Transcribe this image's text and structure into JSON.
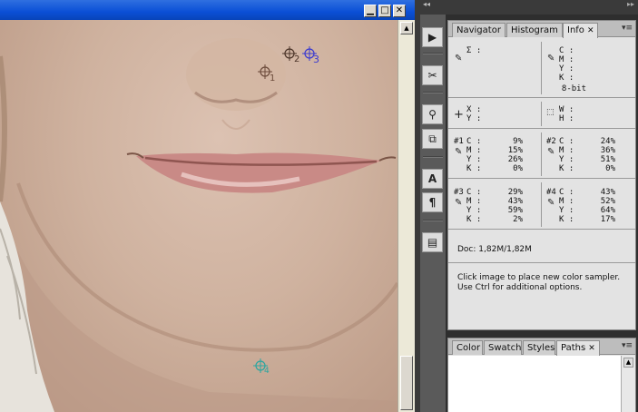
{
  "window": {
    "buttons": {
      "minimize": "▁",
      "maximize": "□",
      "close": "✕"
    }
  },
  "samplers": [
    {
      "label": "1",
      "color": "#6b4a3a"
    },
    {
      "label": "2",
      "color": "#4a3328"
    },
    {
      "label": "3",
      "color": "#3a3ad0"
    },
    {
      "label": "4",
      "color": "#2aa6a0"
    }
  ],
  "toolstrip": {
    "collapse": "◂◂",
    "tools": [
      {
        "name": "actions-icon",
        "glyph": "▶"
      },
      {
        "name": "tools-icon",
        "glyph": "✂"
      },
      {
        "name": "clone-source-icon",
        "glyph": "⚲"
      },
      {
        "name": "tool-presets-icon",
        "glyph": "⧉"
      },
      {
        "name": "character-icon",
        "glyph": "A"
      },
      {
        "name": "paragraph-icon",
        "glyph": "¶"
      },
      {
        "name": "layer-comps-icon",
        "glyph": "▤"
      }
    ]
  },
  "panels_header": {
    "collapse": "▸▸"
  },
  "info_panel": {
    "tabs": [
      "Navigator",
      "Histogram",
      "Info"
    ],
    "active_tab": "Info",
    "close_glyph": "✕",
    "menu_glyph": "▾≡",
    "top_left": {
      "label": "Σ :"
    },
    "top_right": {
      "labels": [
        "C :",
        "M :",
        "Y :",
        "K :"
      ],
      "depth": "8-bit"
    },
    "xy": {
      "x_label": "X :",
      "y_label": "Y :"
    },
    "wh": {
      "w_label": "W :",
      "h_label": "H :"
    },
    "samplers": [
      {
        "id": "#1",
        "C": "9%",
        "M": "15%",
        "Y": "26%",
        "K": "0%"
      },
      {
        "id": "#2",
        "C": "24%",
        "M": "36%",
        "Y": "51%",
        "K": "0%"
      },
      {
        "id": "#3",
        "C": "29%",
        "M": "43%",
        "Y": "59%",
        "K": "2%"
      },
      {
        "id": "#4",
        "C": "43%",
        "M": "52%",
        "Y": "64%",
        "K": "17%"
      }
    ],
    "sampler_labels": {
      "C": "C :",
      "M": "M :",
      "Y": "Y :",
      "K": "K :"
    },
    "doc": "Doc: 1,82M/1,82M",
    "hint_line1": "Click image to place new color sampler.",
    "hint_line2": "Use Ctrl for additional options."
  },
  "paths_panel": {
    "tabs": [
      "Color",
      "Swatches",
      "Styles",
      "Paths"
    ],
    "active_tab": "Paths",
    "close_glyph": "✕",
    "menu_glyph": "▾≡"
  }
}
